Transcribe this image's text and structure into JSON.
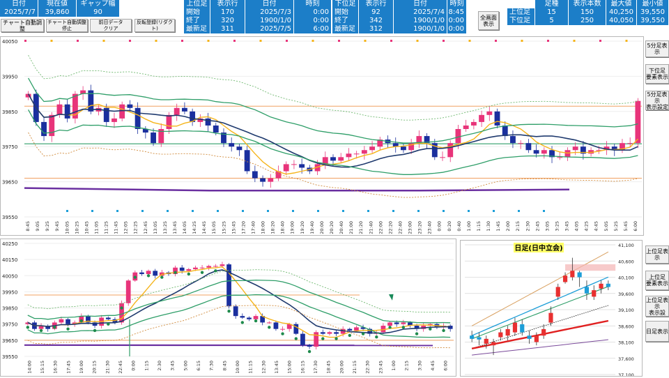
{
  "header": {
    "current": {
      "h_date": "日付",
      "h_price": "現在値",
      "h_gap": "ギャップ幅",
      "date": "2025/7/7",
      "price": "39,860",
      "gap": "90"
    },
    "upper": {
      "title": "上位足",
      "row_label": "表示行",
      "h_date": "日付",
      "h_time": "時刻",
      "rows": [
        {
          "label": "開始",
          "count": "170",
          "date": "2025/7/3",
          "time": "0:00"
        },
        {
          "label": "終了",
          "count": "320",
          "date": "1900/1/0",
          "time": "0:00"
        },
        {
          "label": "最新足",
          "count": "311",
          "date": "2025/7/5",
          "time": "6:00"
        }
      ]
    },
    "lower": {
      "title": "下位足",
      "row_label": "表示行",
      "h_date": "日付",
      "h_time": "時刻",
      "rows": [
        {
          "label": "開始",
          "count": "92",
          "date": "2025/7/4",
          "time": "8:45"
        },
        {
          "label": "終了",
          "count": "342",
          "date": "1900/1/0",
          "time": "0:00"
        },
        {
          "label": "最新足",
          "count": "312",
          "date": "1900/1/0",
          "time": "0:00"
        }
      ]
    },
    "foot": {
      "h_foot": "足種",
      "h_count": "表示本数",
      "h_max": "最大値",
      "h_min": "最小値",
      "rows": [
        {
          "label": "上位足",
          "foot": "15",
          "count": "150",
          "max": "40,250",
          "min": "39,550"
        },
        {
          "label": "下位足",
          "foot": "5",
          "count": "250",
          "max": "40,050",
          "min": "39,550"
        }
      ]
    }
  },
  "buttons": {
    "auto_adjust": "チャート自動調整",
    "auto_stop": "チャート自動調整停止",
    "clear": "前日データ\nクリア",
    "reflect": "反転登録(リダクト)",
    "fullscreen": "全画面\n表示"
  },
  "side_buttons": [
    "5分足表示",
    "下位足\n要素表示",
    "5分足表示\n表示設定",
    "上位足表示",
    "上位足\n要素表示",
    "上位足表示\n表示設",
    "日足表示"
  ],
  "chart_data": [
    {
      "type": "candlestick",
      "name": "main-5min",
      "y_ticks": [
        "40050",
        "39950",
        "39850",
        "39750",
        "39650",
        "39550"
      ],
      "ylim": [
        39550,
        40050
      ],
      "x_labels": [
        "8:45",
        "9:05",
        "9:25",
        "9:45",
        "10:05",
        "10:25",
        "10:45",
        "11:05",
        "11:25",
        "11:45",
        "12:05",
        "12:25",
        "12:45",
        "13:05",
        "13:25",
        "13:45",
        "14:05",
        "14:25",
        "14:45",
        "15:05",
        "15:25",
        "15:45",
        "17:20",
        "17:40",
        "18:00",
        "18:20",
        "18:40",
        "19:00",
        "19:20",
        "19:40",
        "20:00",
        "20:20",
        "20:40",
        "21:00",
        "21:20",
        "21:40",
        "22:00",
        "22:20",
        "22:40",
        "23:00",
        "23:20",
        "23:40",
        "0:00",
        "0:20",
        "0:40",
        "1:00",
        "1:15",
        "1:30",
        "1:45",
        "2:00",
        "2:15",
        "2:30",
        "2:45",
        "3:05",
        "3:25",
        "3:45",
        "4:05",
        "4:25",
        "4:45",
        "5:05",
        "5:25",
        "5:45",
        "6:00"
      ],
      "closes": [
        39900,
        39820,
        39780,
        39840,
        39870,
        39830,
        39900,
        39910,
        39850,
        39860,
        39820,
        39830,
        39870,
        39860,
        39800,
        39790,
        39760,
        39800,
        39840,
        39860,
        39850,
        39820,
        39830,
        39810,
        39790,
        39760,
        39750,
        39740,
        39680,
        39660,
        39650,
        39660,
        39680,
        39700,
        39700,
        39690,
        39680,
        39700,
        39720,
        39710,
        39720,
        39730,
        39730,
        39740,
        39750,
        39770,
        39760,
        39750,
        39740,
        39760,
        39780,
        39760,
        39720,
        39720,
        39760,
        39800,
        39810,
        39820,
        39840,
        39850,
        39810,
        39780,
        39760,
        39760,
        39740,
        39730,
        39740,
        39720,
        39720,
        39740,
        39750,
        39730,
        39740,
        39740,
        39750,
        39740,
        39760,
        39760,
        39880
      ]
    },
    {
      "type": "candlestick",
      "name": "upper-15min",
      "y_ticks": [
        "40250",
        "40150",
        "40050",
        "39950",
        "39850",
        "39750",
        "39650",
        "39550"
      ],
      "ylim": [
        39550,
        40250
      ],
      "x_labels": [
        "14:00",
        "15:15",
        "16:30",
        "17:45",
        "19:00",
        "20:15",
        "21:30",
        "22:45",
        "0:00",
        "1:15",
        "2:30",
        "3:45",
        "5:00",
        "6:15",
        "7:30",
        "8:45",
        "10:00",
        "11:15",
        "12:30",
        "13:45",
        "15:00",
        "16:15",
        "17:30",
        "18:45",
        "20:00",
        "21:15",
        "22:30",
        "23:45",
        "1:00",
        "2:15",
        "3:30",
        "4:45",
        "6:00"
      ],
      "closes": [
        39760,
        39720,
        39740,
        39720,
        39760,
        39780,
        39750,
        39760,
        39800,
        39760,
        39740,
        39790,
        39780,
        39760,
        39880,
        40020,
        40070,
        40060,
        40080,
        40050,
        40070,
        40060,
        40100,
        40080,
        40090,
        40100,
        40100,
        40110,
        40110,
        40120,
        39860,
        39800,
        39790,
        39780,
        39800,
        39760,
        39760,
        39720,
        39720,
        39750,
        39690,
        39620,
        39610,
        39700,
        39690,
        39700,
        39690,
        39720,
        39710,
        39730,
        39720,
        39690,
        39700,
        39740,
        39760,
        39750,
        39760,
        39740,
        39720,
        39740,
        39750,
        39730,
        39740,
        39720
      ]
    },
    {
      "type": "candlestick",
      "name": "daily",
      "title": "日足(日中立会)",
      "y_ticks": [
        "41,100",
        "40,600",
        "40,100",
        "39,600",
        "39,100",
        "38,600",
        "38,100",
        "37,600",
        "37,100"
      ],
      "ylim": [
        37100,
        41100
      ],
      "candles": [
        [
          38300,
          38200,
          38450,
          38100
        ],
        [
          38250,
          38180,
          38400,
          38000
        ],
        [
          38050,
          38200,
          38300,
          37900
        ],
        [
          38000,
          38100,
          38200,
          37700
        ],
        [
          38250,
          38400,
          38500,
          38150
        ],
        [
          38300,
          38500,
          38600,
          38150
        ],
        [
          38400,
          38700,
          38850,
          38300
        ],
        [
          38650,
          38400,
          38800,
          38300
        ],
        [
          38300,
          38200,
          38450,
          38050
        ],
        [
          38100,
          38300,
          38400,
          38000
        ],
        [
          38300,
          38500,
          38650,
          38200
        ],
        [
          38700,
          39000,
          39200,
          38600
        ],
        [
          39500,
          39800,
          39900,
          39400
        ],
        [
          39950,
          40150,
          40250,
          39900
        ],
        [
          40100,
          40300,
          40700,
          40000
        ],
        [
          40250,
          40100,
          40300,
          39800
        ],
        [
          39800,
          39600,
          40000,
          39400
        ],
        [
          39500,
          39700,
          39850,
          39400
        ],
        [
          39750,
          39900,
          40000,
          39600
        ],
        [
          39900,
          39800,
          40000,
          39700
        ]
      ]
    }
  ],
  "colors": {
    "header": "#1c7ec8",
    "bear": "#1a2f9e",
    "bull": "#e8347a",
    "ma_navy": "#1f3a6e",
    "ma_green": "#2e9e68",
    "ma_yellow": "#f5b41a",
    "ma_purple": "#6a2fa0",
    "level_orange": "#f0a060",
    "level_green": "#2e9e68"
  }
}
